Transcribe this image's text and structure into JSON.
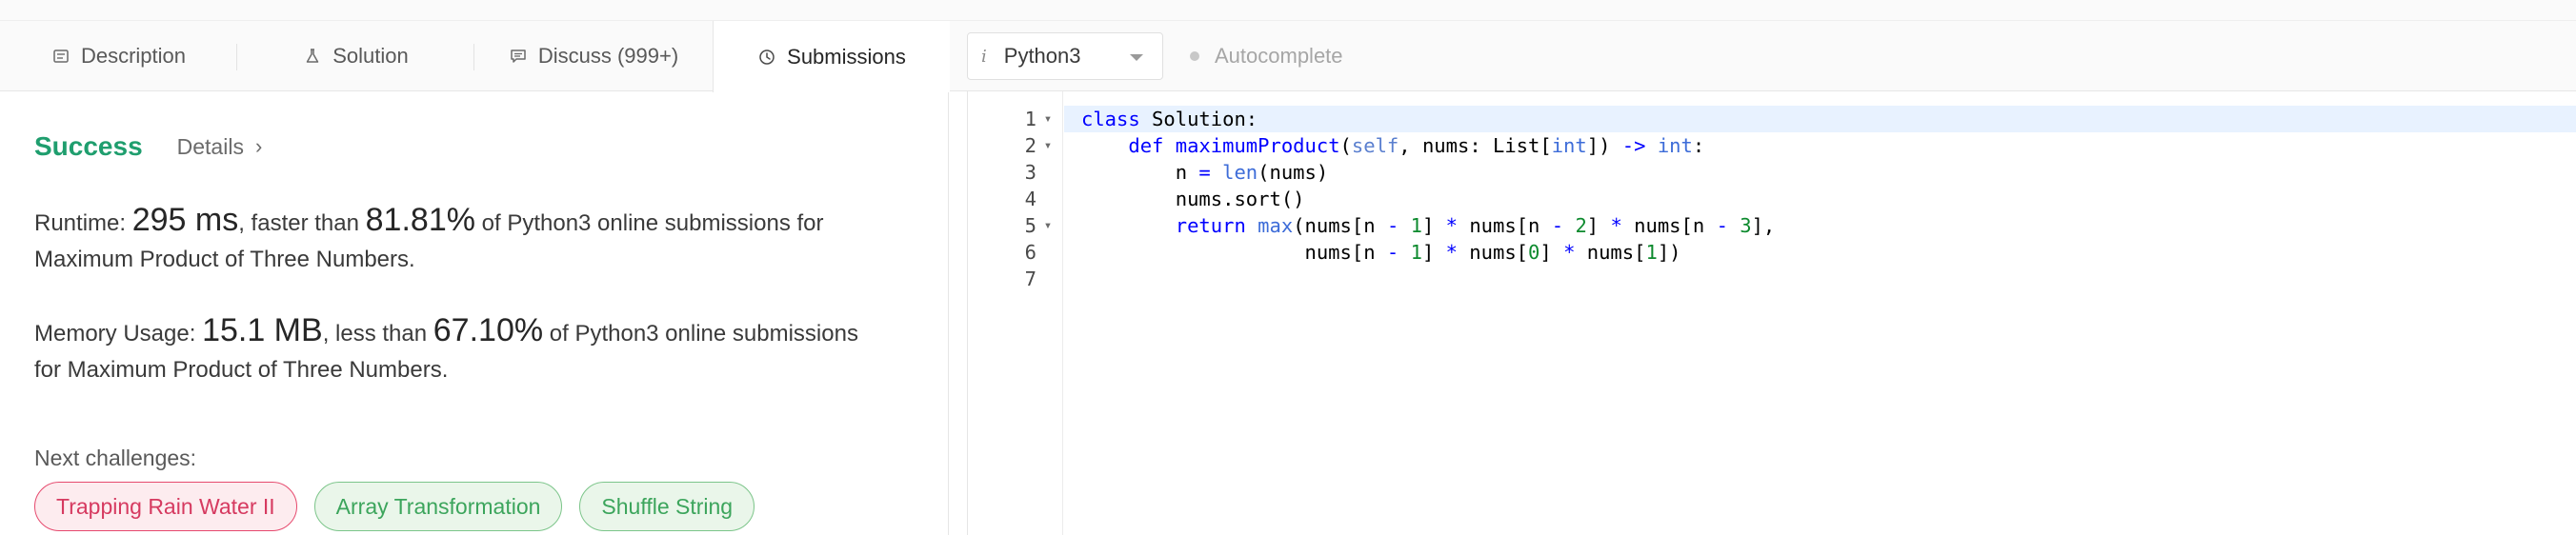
{
  "tabs": [
    {
      "label": "Description",
      "icon": "description-icon"
    },
    {
      "label": "Solution",
      "icon": "flask-icon"
    },
    {
      "label": "Discuss (999+)",
      "icon": "comment-icon"
    },
    {
      "label": "Submissions",
      "icon": "clock-icon"
    }
  ],
  "result": {
    "status": "Success",
    "details_label": "Details"
  },
  "runtime": {
    "label": "Runtime:",
    "value": "295 ms",
    "comparison": ", faster than",
    "percent": "81.81%",
    "suffix": "of Python3 online submissions for",
    "suffix_line2": "Maximum Product of Three Numbers."
  },
  "memory": {
    "label": "Memory Usage:",
    "value": "15.1 MB",
    "comparison": ", less than",
    "percent": "67.10%",
    "suffix": "of Python3 online submissions",
    "suffix_line2": "for Maximum Product of Three Numbers."
  },
  "next": {
    "label": "Next challenges:",
    "challenges": [
      {
        "label": "Trapping Rain Water II",
        "difficulty": "hard"
      },
      {
        "label": "Array Transformation",
        "difficulty": "easy"
      },
      {
        "label": "Shuffle String",
        "difficulty": "easy"
      }
    ]
  },
  "editor": {
    "language": "Python3",
    "info_glyph": "i",
    "autocomplete_label": "Autocomplete",
    "line_numbers": [
      "1",
      "2",
      "3",
      "4",
      "5",
      "6",
      "7"
    ],
    "fold_marks": [
      "▾",
      "▾",
      "",
      "",
      "▾",
      "",
      ""
    ]
  },
  "colors": {
    "success": "#1f9e6e",
    "hard": "#d63a60",
    "easy": "#3ca55c",
    "keyword": "#0000ff",
    "active_line": "#e8f2ff"
  }
}
